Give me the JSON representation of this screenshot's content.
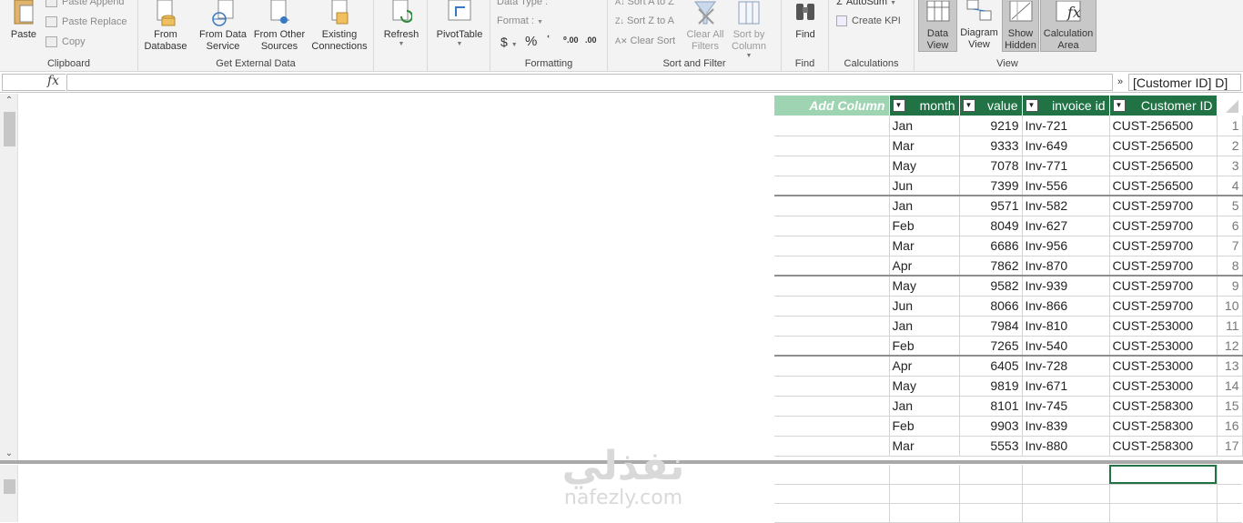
{
  "ribbon": {
    "clipboard": {
      "label": "Clipboard",
      "paste": "Paste",
      "paste_append": "Paste Append",
      "paste_replace": "Paste Replace",
      "copy": "Copy"
    },
    "external": {
      "label": "Get External Data",
      "from_database": "From Database",
      "from_data_service": "From Data Service",
      "from_other_sources": "From Other Sources",
      "existing_connections": "Existing Connections",
      "refresh": "Refresh",
      "pivottable": "PivotTable"
    },
    "formatting": {
      "label": "Formatting",
      "data_type": "Data Type :",
      "format": "Format :",
      "currency": "$",
      "percent": "%",
      "comma": "ʿ",
      "inc_decimal": "⁰.00",
      "dec_decimal": ".00"
    },
    "sort_filter": {
      "label": "Sort and Filter",
      "sort_a_z": "Sort A to Z",
      "sort_z_a": "Sort Z to A",
      "clear_sort": "Clear Sort",
      "clear_all_filters": "Clear All Filters",
      "sort_by_column": "Sort by Column"
    },
    "find": {
      "label": "Find",
      "find": "Find"
    },
    "calculations": {
      "label": "Calculations",
      "autosum": "AutoSum",
      "create_kpi": "Create KPI"
    },
    "view": {
      "label": "View",
      "data_view": "Data View",
      "diagram_view": "Diagram View",
      "show_hidden": "Show Hidden",
      "calculation_area": "Calculation Area"
    }
  },
  "formula_bar": {
    "fx": "fx",
    "expand": "»",
    "content": "[Customer ID]  D]"
  },
  "table": {
    "add_column": "Add Column",
    "columns": [
      "month",
      "value",
      "invoice id",
      "Customer ID"
    ],
    "rows": [
      [
        "Jan",
        "9219",
        "Inv-721",
        "CUST-256500",
        "1"
      ],
      [
        "Mar",
        "9333",
        "Inv-649",
        "CUST-256500",
        "2"
      ],
      [
        "May",
        "7078",
        "Inv-771",
        "CUST-256500",
        "3"
      ],
      [
        "Jun",
        "7399",
        "Inv-556",
        "CUST-256500",
        "4"
      ],
      [
        "Jan",
        "9571",
        "Inv-582",
        "CUST-259700",
        "5"
      ],
      [
        "Feb",
        "8049",
        "Inv-627",
        "CUST-259700",
        "6"
      ],
      [
        "Mar",
        "6686",
        "Inv-956",
        "CUST-259700",
        "7"
      ],
      [
        "Apr",
        "7862",
        "Inv-870",
        "CUST-259700",
        "8"
      ],
      [
        "May",
        "9582",
        "Inv-939",
        "CUST-259700",
        "9"
      ],
      [
        "Jun",
        "8066",
        "Inv-866",
        "CUST-259700",
        "10"
      ],
      [
        "Jan",
        "7984",
        "Inv-810",
        "CUST-253000",
        "11"
      ],
      [
        "Feb",
        "7265",
        "Inv-540",
        "CUST-253000",
        "12"
      ],
      [
        "Apr",
        "6405",
        "Inv-728",
        "CUST-253000",
        "13"
      ],
      [
        "May",
        "9819",
        "Inv-671",
        "CUST-253000",
        "14"
      ],
      [
        "Jan",
        "8101",
        "Inv-745",
        "CUST-258300",
        "15"
      ],
      [
        "Feb",
        "9903",
        "Inv-839",
        "CUST-258300",
        "16"
      ],
      [
        "Mar",
        "5553",
        "Inv-880",
        "CUST-258300",
        "17"
      ]
    ]
  },
  "watermark": {
    "arabic": "نفذلي",
    "latin": "nafezly.com"
  },
  "colors": {
    "header": "#217346",
    "add_column": "#9fd4b3",
    "ribbon_bg": "#f3f3f3"
  }
}
